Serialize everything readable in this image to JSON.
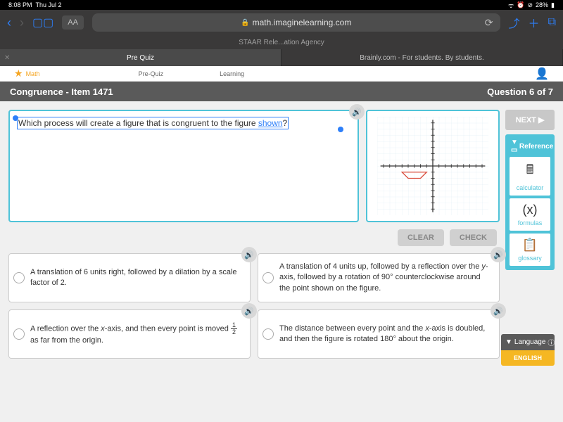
{
  "status": {
    "time": "8:08 PM",
    "date": "Thu Jul 2",
    "battery": "28%"
  },
  "browser": {
    "aa": "AA",
    "url_host": "math.imaginelearning.com",
    "subtitle": "STAAR Rele...ation Agency"
  },
  "tabs": [
    {
      "label": "Pre Quiz"
    },
    {
      "label": "Brainly.com - For students. By students."
    }
  ],
  "app_header": {
    "logo": "Math",
    "items": [
      "Pre-Quiz",
      "Learning"
    ]
  },
  "question_bar": {
    "title": "Congruence - Item 1471",
    "counter": "Question 6 of 7"
  },
  "question": {
    "prefix": "Which process will create a figure that is congruent to the figure ",
    "link": "shown",
    "suffix": "?"
  },
  "actions": {
    "clear": "CLEAR",
    "check": "CHECK",
    "next": "NEXT"
  },
  "answers": {
    "a": "A translation of 6 units right, followed by a dilation by a scale factor of 2.",
    "b_pre": "A translation of 4 units up, followed by a reflection over the ",
    "b_axis": "y",
    "b_post": "-axis, followed by a rotation of 90° counterclockwise around the point shown on the figure.",
    "c_pre": "A reflection over the ",
    "c_axis": "x",
    "c_mid": "-axis, and then every point is moved ",
    "c_frac_num": "1",
    "c_frac_den": "2",
    "c_post": " as far from the origin.",
    "d_pre": "The distance between every point and the ",
    "d_axis": "x",
    "d_post": "-axis is doubled, and then the figure is rotated 180° about the origin."
  },
  "reference": {
    "title": "Reference",
    "items": [
      {
        "icon": "calc",
        "label": "calculator"
      },
      {
        "icon": "formula",
        "label": "formulas"
      },
      {
        "icon": "glossary",
        "label": "glossary"
      }
    ]
  },
  "language": {
    "title": "Language",
    "button": "ENGLISH"
  },
  "chart_data": {
    "type": "coordinate-plane",
    "x_range": [
      -9,
      9
    ],
    "y_range": [
      -8,
      8
    ],
    "shape": "trapezoid",
    "vertices": [
      [
        -5,
        -1
      ],
      [
        -1,
        -1
      ],
      [
        -2,
        -2
      ],
      [
        -4,
        -2
      ]
    ],
    "shape_color": "#d94a3a"
  }
}
